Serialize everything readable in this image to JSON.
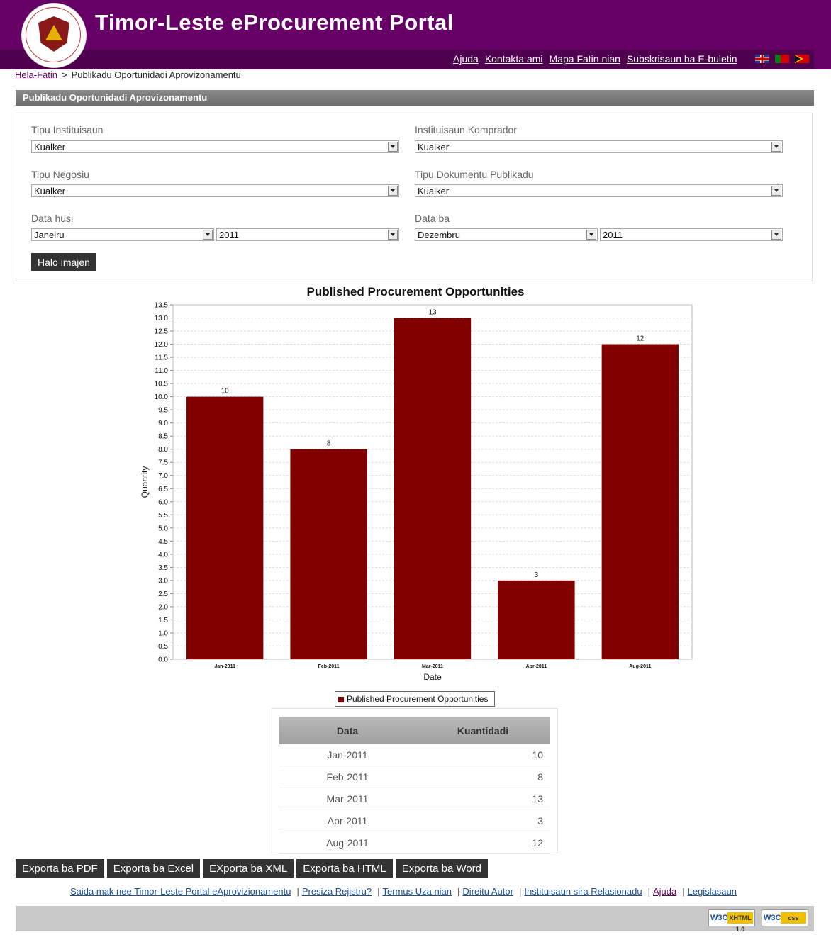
{
  "header": {
    "title": "Timor-Leste eProcurement Portal",
    "links": [
      "Ajuda",
      "Kontakta ami",
      "Mapa Fatin nian",
      "Subskrisaun ba E-buletin"
    ],
    "flags": [
      "flag-uk-icon",
      "flag-pt-icon",
      "flag-tl-icon"
    ]
  },
  "breadcrumb": {
    "home": "Hela-Fatin",
    "separator": ">",
    "current": "Publikadu Oportunidadi Aprovizonamentu"
  },
  "section_title": "Publikadu Oportunidadi Aprovizonamentu",
  "filters": {
    "institution_type": {
      "label": "Tipu Instituisaun",
      "value": "Kualker"
    },
    "buying_institution": {
      "label": "Instituisaun Komprador",
      "value": "Kualker"
    },
    "business_type": {
      "label": "Tipu Negosiu",
      "value": "Kualker"
    },
    "document_type": {
      "label": "Tipu Dokumentu Publikadu",
      "value": "Kualker"
    },
    "date_from": {
      "label": "Data husi",
      "month": "Janeiru",
      "year": "2011"
    },
    "date_to": {
      "label": "Data ba",
      "month": "Dezembru",
      "year": "2011"
    },
    "generate_button": "Halo imajen"
  },
  "chart_data": {
    "type": "bar",
    "title": "Published Procurement Opportunities",
    "xlabel": "Date",
    "ylabel": "Quantity",
    "categories": [
      "Jan-2011",
      "Feb-2011",
      "Mar-2011",
      "Apr-2011",
      "Aug-2011"
    ],
    "series": [
      {
        "name": "Published Procurement Opportunities",
        "values": [
          10,
          8,
          13,
          3,
          12
        ]
      }
    ],
    "ylim": [
      0,
      13.5
    ],
    "ytick_step": 0.5,
    "grid": true,
    "legend": "bottom",
    "bar_color": "#800000"
  },
  "table": {
    "headers": [
      "Data",
      "Kuantidadi"
    ],
    "rows": [
      [
        "Jan-2011",
        "10"
      ],
      [
        "Feb-2011",
        "8"
      ],
      [
        "Mar-2011",
        "13"
      ],
      [
        "Apr-2011",
        "3"
      ],
      [
        "Aug-2011",
        "12"
      ]
    ]
  },
  "exports": [
    "Exporta ba PDF",
    "Exporta ba Excel",
    "EXporta ba XML",
    "Exporta ba HTML",
    "Exporta ba Word"
  ],
  "footer": {
    "links": [
      "Saida mak nee Timor-Leste Portal eAprovizionamentu",
      "Presiza Rejistru?",
      "Termus Uza nian",
      "Direitu Autor",
      "Instituisaun sira Relasionadu",
      "Ajuda",
      "Legislasaun"
    ],
    "badges": [
      {
        "name": "w3c-xhtml-badge",
        "w3c": "W3C",
        "label": "XHTML 1.0"
      },
      {
        "name": "w3c-css-badge",
        "w3c": "W3C",
        "label": "css"
      }
    ]
  },
  "colors": {
    "header": "#660066",
    "bar": "#800000",
    "button": "#333333"
  }
}
